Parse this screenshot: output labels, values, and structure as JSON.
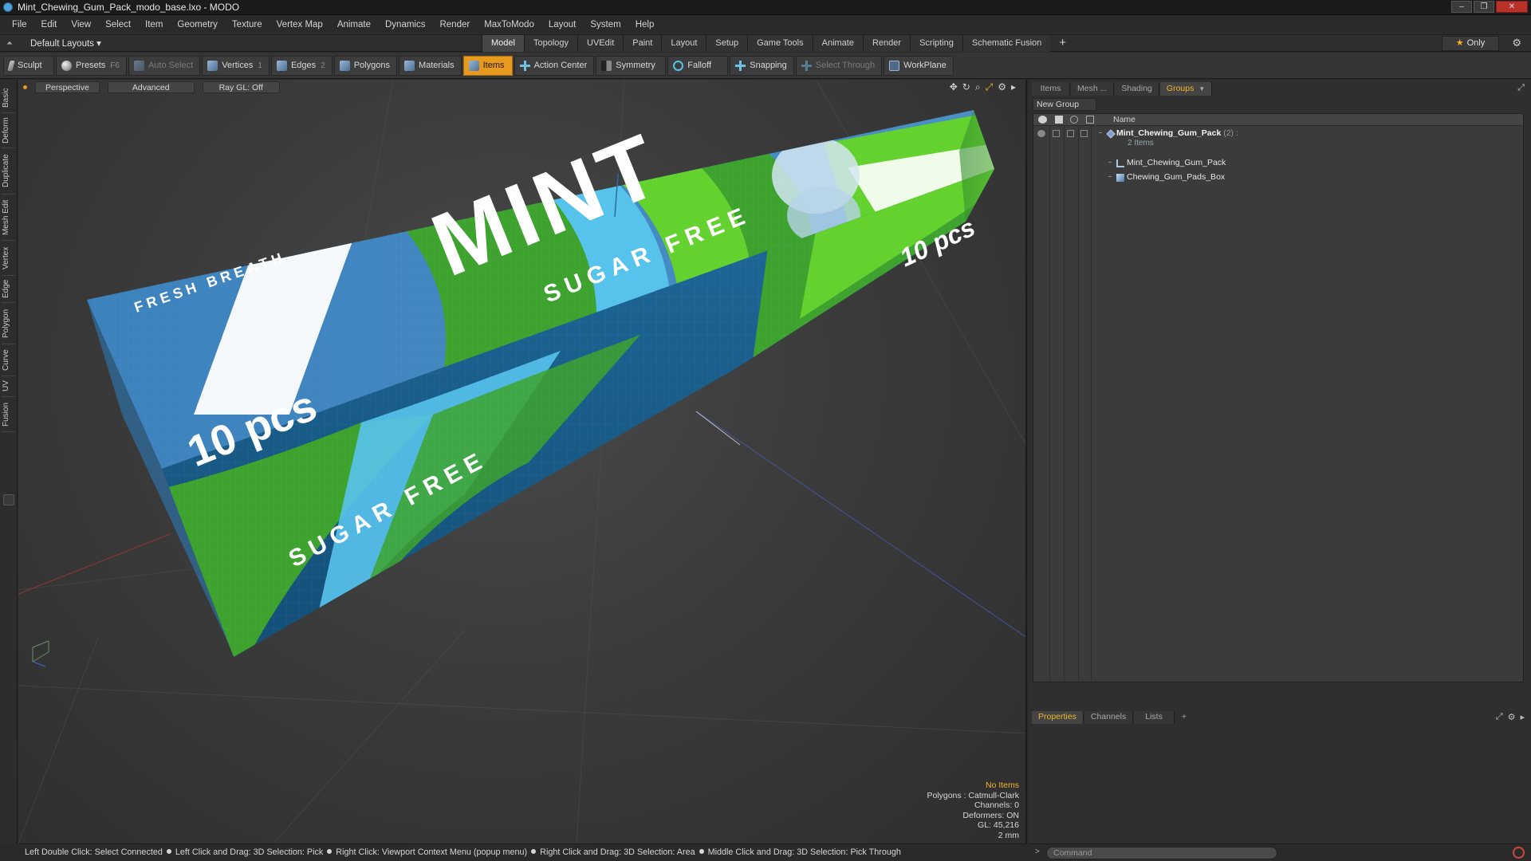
{
  "window": {
    "title": "Mint_Chewing_Gum_Pack_modo_base.lxo - MODO"
  },
  "menu": [
    "File",
    "Edit",
    "View",
    "Select",
    "Item",
    "Geometry",
    "Texture",
    "Vertex Map",
    "Animate",
    "Dynamics",
    "Render",
    "MaxToModo",
    "Layout",
    "System",
    "Help"
  ],
  "layout": {
    "default_layouts": "Default Layouts ▾",
    "tabs": [
      "Model",
      "Topology",
      "UVEdit",
      "Paint",
      "Layout",
      "Setup",
      "Game Tools",
      "Animate",
      "Render",
      "Scripting",
      "Schematic Fusion"
    ],
    "active_tab": "Model",
    "add_tab": "+",
    "only": "Only"
  },
  "toolbar": {
    "sculpt": "Sculpt",
    "presets": "Presets",
    "presets_key": "F6",
    "auto_select": "Auto Select",
    "vertices": "Vertices",
    "vertices_key": "1",
    "edges": "Edges",
    "edges_key": "2",
    "polygons": "Polygons",
    "materials": "Materials",
    "items": "Items",
    "action_center": "Action Center",
    "symmetry": "Symmetry",
    "falloff": "Falloff",
    "snapping": "Snapping",
    "select_through": "Select Through",
    "workplane": "WorkPlane"
  },
  "left_tabs": [
    "Basic",
    "Deform",
    "Duplicate",
    "Mesh Edit",
    "Vertex",
    "Edge",
    "Polygon",
    "Curve",
    "UV",
    "Fusion"
  ],
  "viewport": {
    "perspective": "Perspective",
    "advanced": "Advanced",
    "raygl": "Ray GL: Off",
    "stats": {
      "no_items": "No Items",
      "polygons": "Polygons : Catmull-Clark",
      "channels": "Channels: 0",
      "deformers": "Deformers: ON",
      "gl": "GL: 45,216",
      "unit": "2 mm"
    },
    "pack_text": {
      "fresh_breath": "FRESH BREATH",
      "mint": "MINT",
      "sugar_free_top": "SUGAR FREE",
      "sugar_free_side": "SUGAR FREE",
      "ten_pcs_front": "10 pcs",
      "ten_pcs_end": "10 pcs"
    },
    "colors": {
      "pack_blue": "#3b7eb8",
      "pack_green": "#3da32e",
      "pack_light_green": "#63d22e",
      "pack_cyan": "#56c3ec",
      "pack_dark_blue": "#185f8c"
    }
  },
  "right_panel": {
    "tabs": [
      "Items",
      "Mesh ...",
      "Shading",
      "Groups"
    ],
    "active_tab": "Groups",
    "new_group": "New Group",
    "column_name": "Name",
    "rows": [
      {
        "name": "Mint_Chewing_Gum_Pack",
        "count": "(2) :",
        "sub": "2 Items"
      },
      {
        "name": "Mint_Chewing_Gum_Pack"
      },
      {
        "name": "Chewing_Gum_Pads_Box"
      }
    ],
    "prop_tabs": [
      "Properties",
      "Channels",
      "Lists"
    ],
    "prop_active": "Properties",
    "prop_add": "+"
  },
  "command": {
    "placeholder": "Command",
    "arrow": ">"
  },
  "status": {
    "items": [
      "Left Double Click: Select Connected",
      "Left Click and Drag: 3D Selection: Pick",
      "Right Click: Viewport Context Menu (popup menu)",
      "Right Click and Drag: 3D Selection: Area",
      "Middle Click and Drag: 3D Selection: Pick Through"
    ]
  }
}
